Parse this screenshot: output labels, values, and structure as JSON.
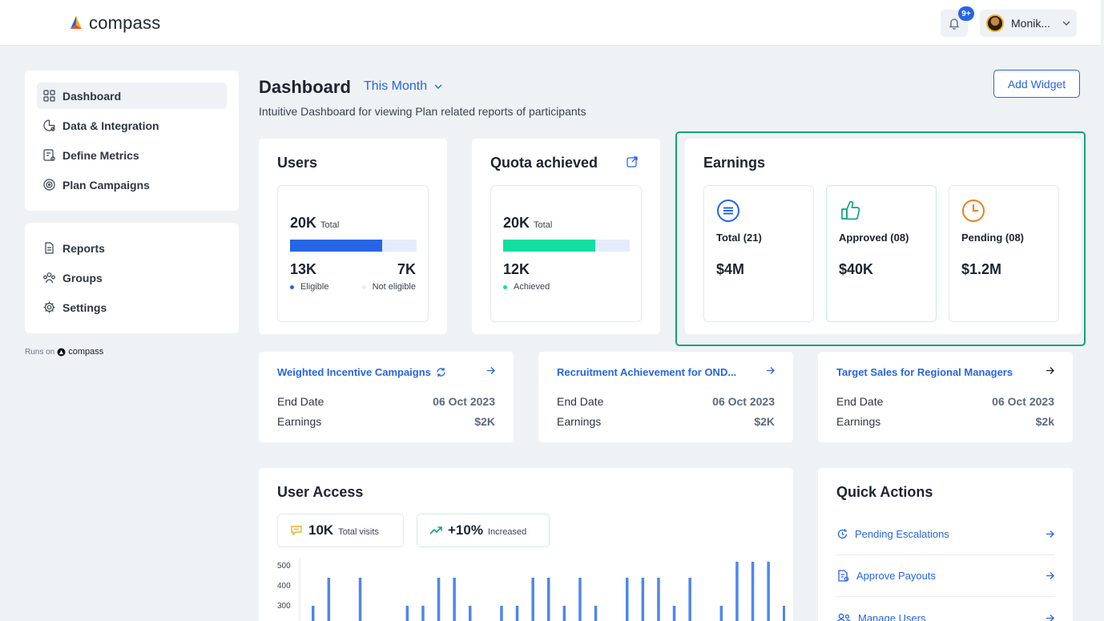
{
  "app": {
    "name": "compass",
    "notifications_badge": "9+",
    "user_name": "Monik..."
  },
  "sidebar": {
    "primary": [
      {
        "label": "Dashboard",
        "icon": "dashboard-icon",
        "active": true
      },
      {
        "label": "Data & Integration",
        "icon": "data-integration-icon"
      },
      {
        "label": "Define Metrics",
        "icon": "metrics-icon"
      },
      {
        "label": "Plan Campaigns",
        "icon": "target-icon"
      }
    ],
    "secondary": [
      {
        "label": "Reports",
        "icon": "document-icon"
      },
      {
        "label": "Groups",
        "icon": "users-icon"
      },
      {
        "label": "Settings",
        "icon": "gear-icon"
      }
    ],
    "runs_on_label": "Runs on",
    "runs_on_brand": "compass"
  },
  "header": {
    "title": "Dashboard",
    "period": "This Month",
    "subtitle": "Intuitive Dashboard for viewing Plan related reports of participants",
    "add_widget": "Add Widget"
  },
  "users_card": {
    "title": "Users",
    "total": "20K",
    "total_label": "Total",
    "eligible_fraction": 0.73,
    "eligible_value": "13K",
    "eligible_label": "Eligible",
    "not_eligible_value": "7K",
    "not_eligible_label": "Not eligible",
    "colors": {
      "eligible": "#2665e6",
      "not_eligible": "#e4ecfb"
    }
  },
  "quota_card": {
    "title": "Quota achieved",
    "total": "20K",
    "total_label": "Total",
    "achieved_fraction": 0.73,
    "achieved_value": "12K",
    "achieved_label": "Achieved",
    "colors": {
      "achieved": "#12dfa0",
      "remaining": "#e4ecfb"
    }
  },
  "earnings": {
    "title": "Earnings",
    "items": [
      {
        "label": "Total (21)",
        "value": "$4M",
        "icon": "equals-circle-icon",
        "color": "#2665e6"
      },
      {
        "label": "Approved (08)",
        "value": "$40K",
        "icon": "thumbs-up-icon",
        "color": "#12a37a"
      },
      {
        "label": "Pending (08)",
        "value": "$1.2M",
        "icon": "clock-icon",
        "color": "#e8821c"
      }
    ]
  },
  "campaigns": [
    {
      "title": "Weighted Incentive Campaigns",
      "end_date_label": "End Date",
      "end_date": "06 Oct 2023",
      "earnings_label": "Earnings",
      "earnings": "$2K",
      "has_sync_icon": true
    },
    {
      "title": "Recruitment Achievement for OND...",
      "end_date_label": "End Date",
      "end_date": "06 Oct 2023",
      "earnings_label": "Earnings",
      "earnings": "$2K"
    },
    {
      "title": "Target Sales for Regional Managers",
      "end_date_label": "End Date",
      "end_date": "06 Oct 2023",
      "earnings_label": "Earnings",
      "earnings": "$2k"
    }
  ],
  "user_access": {
    "title": "User Access",
    "visits_value": "10K",
    "visits_label": "Total visits",
    "change_value": "+10%",
    "change_label": "Increased"
  },
  "chart_data": {
    "type": "bar",
    "title": "",
    "yticks": [
      "500",
      "400",
      "300"
    ],
    "ylim": [
      0,
      500
    ],
    "values": [
      300,
      440,
      0,
      440,
      0,
      0,
      300,
      300,
      440,
      440,
      300,
      0,
      300,
      300,
      440,
      440,
      300,
      440,
      300,
      0,
      440,
      440,
      440,
      300,
      440,
      0,
      300,
      520,
      520,
      520,
      300
    ],
    "color": "#4f86ed"
  },
  "quick_actions": {
    "title": "Quick Actions",
    "items": [
      {
        "label": "Pending Escalations",
        "icon": "escalation-icon"
      },
      {
        "label": "Approve Payouts",
        "icon": "payout-icon"
      },
      {
        "label": "Manage Users",
        "icon": "manage-users-icon"
      }
    ]
  }
}
